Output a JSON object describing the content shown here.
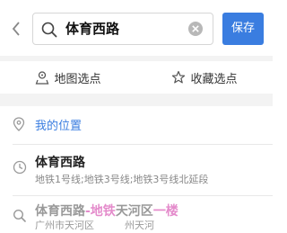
{
  "header": {
    "search_value": "体育西路",
    "save_label": "保存"
  },
  "options": {
    "map_pick_label": "地图选点",
    "favorite_pick_label": "收藏选点"
  },
  "my_location_label": "我的位置",
  "results": [
    {
      "title": "体育西路",
      "subtitle": "地铁1号线;地铁3号线;地铁3号线北延段"
    },
    {
      "title_main": "体育西路",
      "title_hl": "-地铁",
      "title_mid": "天河区",
      "title_tail": "一楼",
      "subtitle": "广州市天河区",
      "subtitle_tail": "州天河"
    }
  ],
  "colors": {
    "accent": "#3a7de0",
    "highlight": "#e48bcb"
  }
}
